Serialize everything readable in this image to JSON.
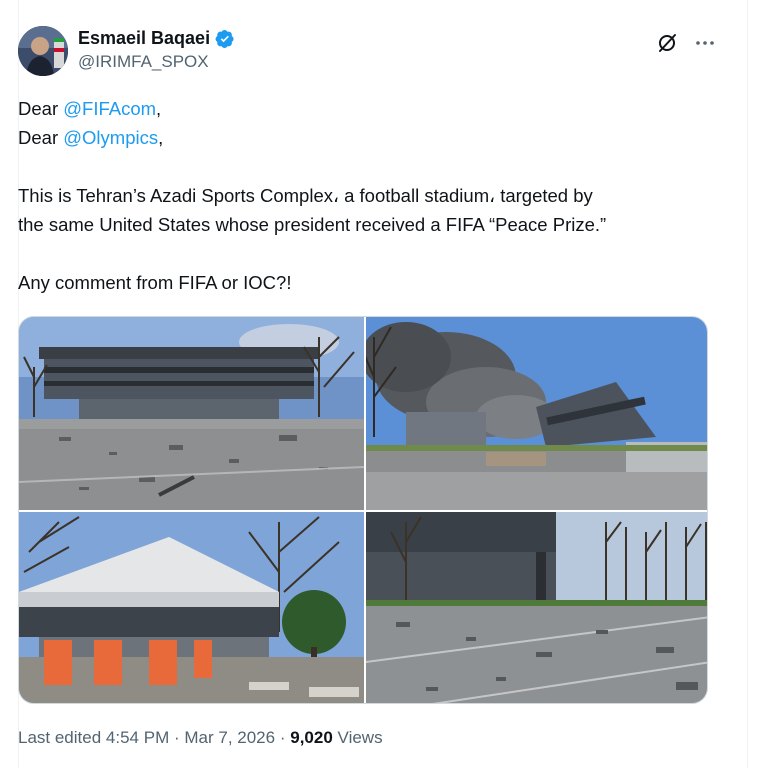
{
  "author": {
    "display_name": "Esmaeil Baqaei",
    "handle": "@IRIMFA_SPOX",
    "verified": true,
    "verified_color": "#1d9bf0"
  },
  "tweet": {
    "line1_prefix": "Dear ",
    "line1_mention": "@FIFAcom",
    "line1_suffix": ",",
    "line2_prefix": "Dear ",
    "line2_mention": "@Olympics",
    "line2_suffix": ",",
    "para2_line1": "This is Tehran’s Azadi Sports Complex، a football stadium، targeted by",
    "para2_line2": "the same United States whose president received a FIFA “Peace Prize.”",
    "para3": "Any comment from FIFA or IOC?!"
  },
  "media": {
    "photos": [
      {
        "name": "damaged stadium front view"
      },
      {
        "name": "stadium with smoke"
      },
      {
        "name": "stadium side with barriers"
      },
      {
        "name": "debris covered road"
      }
    ]
  },
  "meta": {
    "edited_label": "Last edited",
    "time": "4:54 PM",
    "separator": "·",
    "date": "Mar 7, 2026",
    "views_count": "9,020",
    "views_label": "Views"
  },
  "icons": {
    "grok": "grok-icon",
    "more": "more-icon",
    "verified": "verified-badge-icon"
  },
  "colors": {
    "mention": "#1d9bf0",
    "secondary_text": "#536471",
    "primary_text": "#0f1419"
  }
}
